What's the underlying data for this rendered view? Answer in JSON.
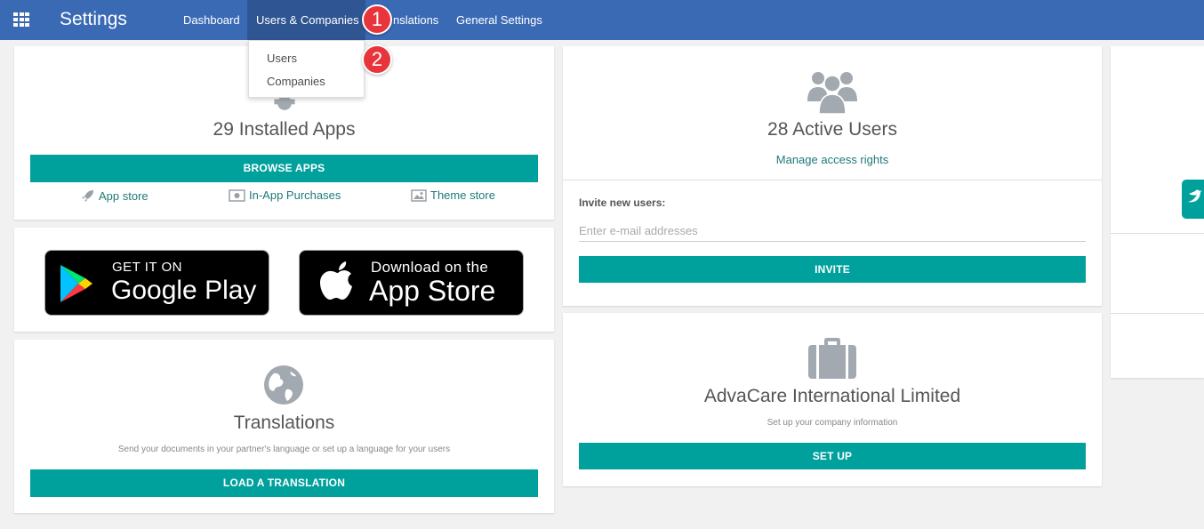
{
  "topbar": {
    "title": "Settings",
    "nav": [
      {
        "label": "Dashboard"
      },
      {
        "label": "Users & Companies"
      },
      {
        "label": "Translations"
      },
      {
        "label": "General Settings"
      }
    ],
    "translations_visible": "nslations"
  },
  "dropdown": {
    "items": [
      {
        "label": "Users"
      },
      {
        "label": "Companies"
      }
    ]
  },
  "badges": [
    "1",
    "2"
  ],
  "apps_card": {
    "title": "29 Installed Apps",
    "button": "BROWSE APPS",
    "links": [
      {
        "label": "App store",
        "icon": "rocket-icon"
      },
      {
        "label": "In-App Purchases",
        "icon": "money-icon"
      },
      {
        "label": "Theme store",
        "icon": "picture-icon"
      }
    ]
  },
  "store_card": {
    "google": {
      "line1": "GET IT ON",
      "line2": "Google Play"
    },
    "apple": {
      "line1": "Download on the",
      "line2": "App Store"
    }
  },
  "translations_card": {
    "title": "Translations",
    "description": "Send your documents in your partner's language or set up a language for your users",
    "button": "LOAD A TRANSLATION"
  },
  "users_card": {
    "title": "28 Active Users",
    "link": "Manage access rights",
    "invite_label": "Invite new users:",
    "invite_placeholder": "Enter e-mail addresses",
    "button": "INVITE"
  },
  "company_card": {
    "title": "AdvaCare International Limited",
    "description": "Set up your company information",
    "button": "SET UP"
  },
  "colors": {
    "topbar": "#3b6ab5",
    "active_nav": "#2f5592",
    "teal": "#00a09d",
    "badge": "#e8353b"
  }
}
